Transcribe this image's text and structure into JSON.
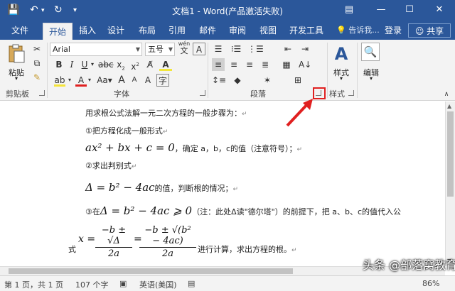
{
  "titlebar": {
    "title": "文档1 - Word(产品激活失败)",
    "save_icon": "save-icon",
    "undo_icon": "undo-icon",
    "redo_icon": "redo-icon"
  },
  "tabs": [
    {
      "label": "文件"
    },
    {
      "label": "开始"
    },
    {
      "label": "插入"
    },
    {
      "label": "设计"
    },
    {
      "label": "布局"
    },
    {
      "label": "引用"
    },
    {
      "label": "邮件"
    },
    {
      "label": "审阅"
    },
    {
      "label": "视图"
    },
    {
      "label": "开发工具"
    }
  ],
  "tellme": "告诉我...",
  "signin": "登录",
  "share": "共享",
  "ribbon": {
    "clipboard": {
      "paste": "粘贴",
      "label": "剪贴板"
    },
    "font": {
      "name": "Arial",
      "size": "五号",
      "wen": "wén",
      "label": "字体"
    },
    "paragraph": {
      "label": "段落"
    },
    "styles": {
      "button": "样式",
      "label": "样式"
    },
    "editing": {
      "button": "编辑"
    }
  },
  "document": {
    "line1": "用求根公式法解一元二次方程的一般步骤为：",
    "line2": "①把方程化成一般形式",
    "line3_math": "ax² + bx + c = 0",
    "line3_text": "，确定 a，b，c的值（注意符号）；",
    "line4": "②求出判别式",
    "line5_math": "Δ = b² − 4ac",
    "line5_text": "的值，判断根的情况；",
    "line6_prefix": "③在",
    "line6_math": "Δ = b² − 4ac ⩾ 0",
    "line6_text": "（注：此处Δ读\"德尔塔\"）的前提下，把 a、b、c的值代入公",
    "line7_prefix": "式",
    "line7_x": "x =",
    "frac1_num": "−b ± √Δ",
    "frac1_den": "2a",
    "eq": "=",
    "frac2_num": "−b ± √(b² − 4ac)",
    "frac2_den": "2a",
    "line7_text": "进行计算，求出方程的根。",
    "para_mark": "↵"
  },
  "status": {
    "page": "第 1 页，共 1 页",
    "words": "107 个字",
    "lang": "英语(美国)",
    "zoom": "86%"
  },
  "watermark": "头条 @部落窝教育"
}
